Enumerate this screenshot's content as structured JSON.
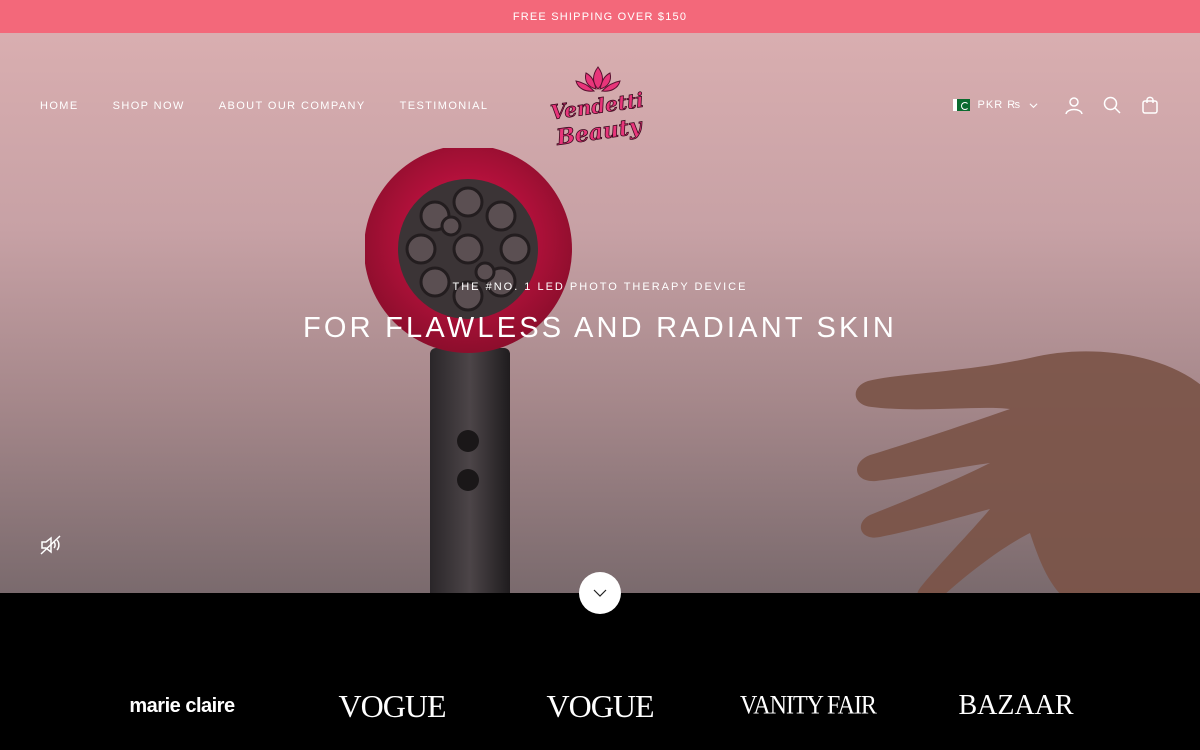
{
  "announcement": {
    "text": "FREE SHIPPING OVER $150"
  },
  "header": {
    "nav": [
      "HOME",
      "SHOP NOW",
      "ABOUT OUR COMPANY",
      "TESTIMONIAL"
    ],
    "logo": {
      "line1": "Vendetti",
      "line2": "Beauty"
    },
    "currency": {
      "label": "PKR ₨",
      "flag": "pakistan-flag"
    },
    "icons": [
      "account-icon",
      "search-icon",
      "cart-icon"
    ]
  },
  "hero": {
    "subheading": "THE #NO. 1 LED PHOTO THERAPY DEVICE",
    "heading": "FOR FLAWLESS AND RADIANT SKIN",
    "mute_icon": "speaker-muted-icon",
    "scroll_icon": "chevron-down-icon"
  },
  "press": [
    "marie claire",
    "VOGUE",
    "VOGUE",
    "VANITY FAIR",
    "BAZAAR"
  ],
  "colors": {
    "announcement_bg": "#f3687a",
    "logo_pink": "#e8357a",
    "device_red": "#b8133a"
  }
}
